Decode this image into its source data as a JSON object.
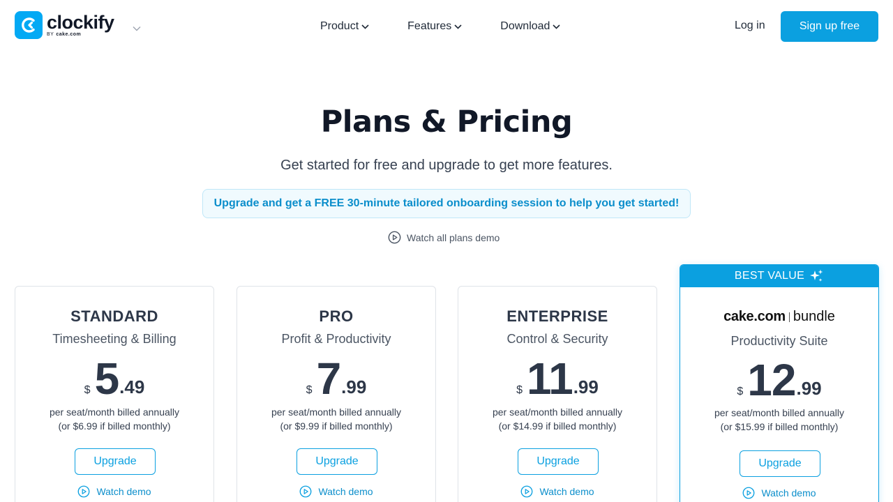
{
  "brand": {
    "name": "clockify",
    "byline_prefix": "BY",
    "byline_brand": "cake.com",
    "accent_color": "#03a9f4"
  },
  "nav": {
    "items": [
      {
        "label": "Product"
      },
      {
        "label": "Features"
      },
      {
        "label": "Download"
      }
    ],
    "login_label": "Log in",
    "signup_label": "Sign up free"
  },
  "hero": {
    "title": "Plans & Pricing",
    "subtitle": "Get started for free and upgrade to get more features.",
    "promo": "Upgrade and get a FREE 30-minute tailored onboarding session to help you get started!",
    "demo_all_label": "Watch all plans demo"
  },
  "plans": [
    {
      "name": "STANDARD",
      "tagline": "Timesheeting & Billing",
      "currency": "$",
      "price_int": "5",
      "price_dec": ".49",
      "billed_line1": "per seat/month billed annually",
      "billed_line2": "(or $6.99 if billed monthly)",
      "upgrade_label": "Upgrade",
      "demo_label": "Watch demo"
    },
    {
      "name": "PRO",
      "tagline": "Profit & Productivity",
      "currency": "$",
      "price_int": "7",
      "price_dec": ".99",
      "billed_line1": "per seat/month billed annually",
      "billed_line2": "(or $9.99 if billed monthly)",
      "upgrade_label": "Upgrade",
      "demo_label": "Watch demo"
    },
    {
      "name": "ENTERPRISE",
      "tagline": "Control & Security",
      "currency": "$",
      "price_int": "11",
      "price_dec": ".99",
      "billed_line1": "per seat/month billed annually",
      "billed_line2": "(or $14.99 if billed monthly)",
      "upgrade_label": "Upgrade",
      "demo_label": "Watch demo"
    },
    {
      "badge": "BEST VALUE",
      "bundle_brand": "cake.com",
      "bundle_label": "bundle",
      "tagline": "Productivity Suite",
      "currency": "$",
      "price_int": "12",
      "price_dec": ".99",
      "billed_line1": "per seat/month billed annually",
      "billed_line2": "(or $15.99 if billed monthly)",
      "upgrade_label": "Upgrade",
      "demo_label": "Watch demo"
    }
  ]
}
